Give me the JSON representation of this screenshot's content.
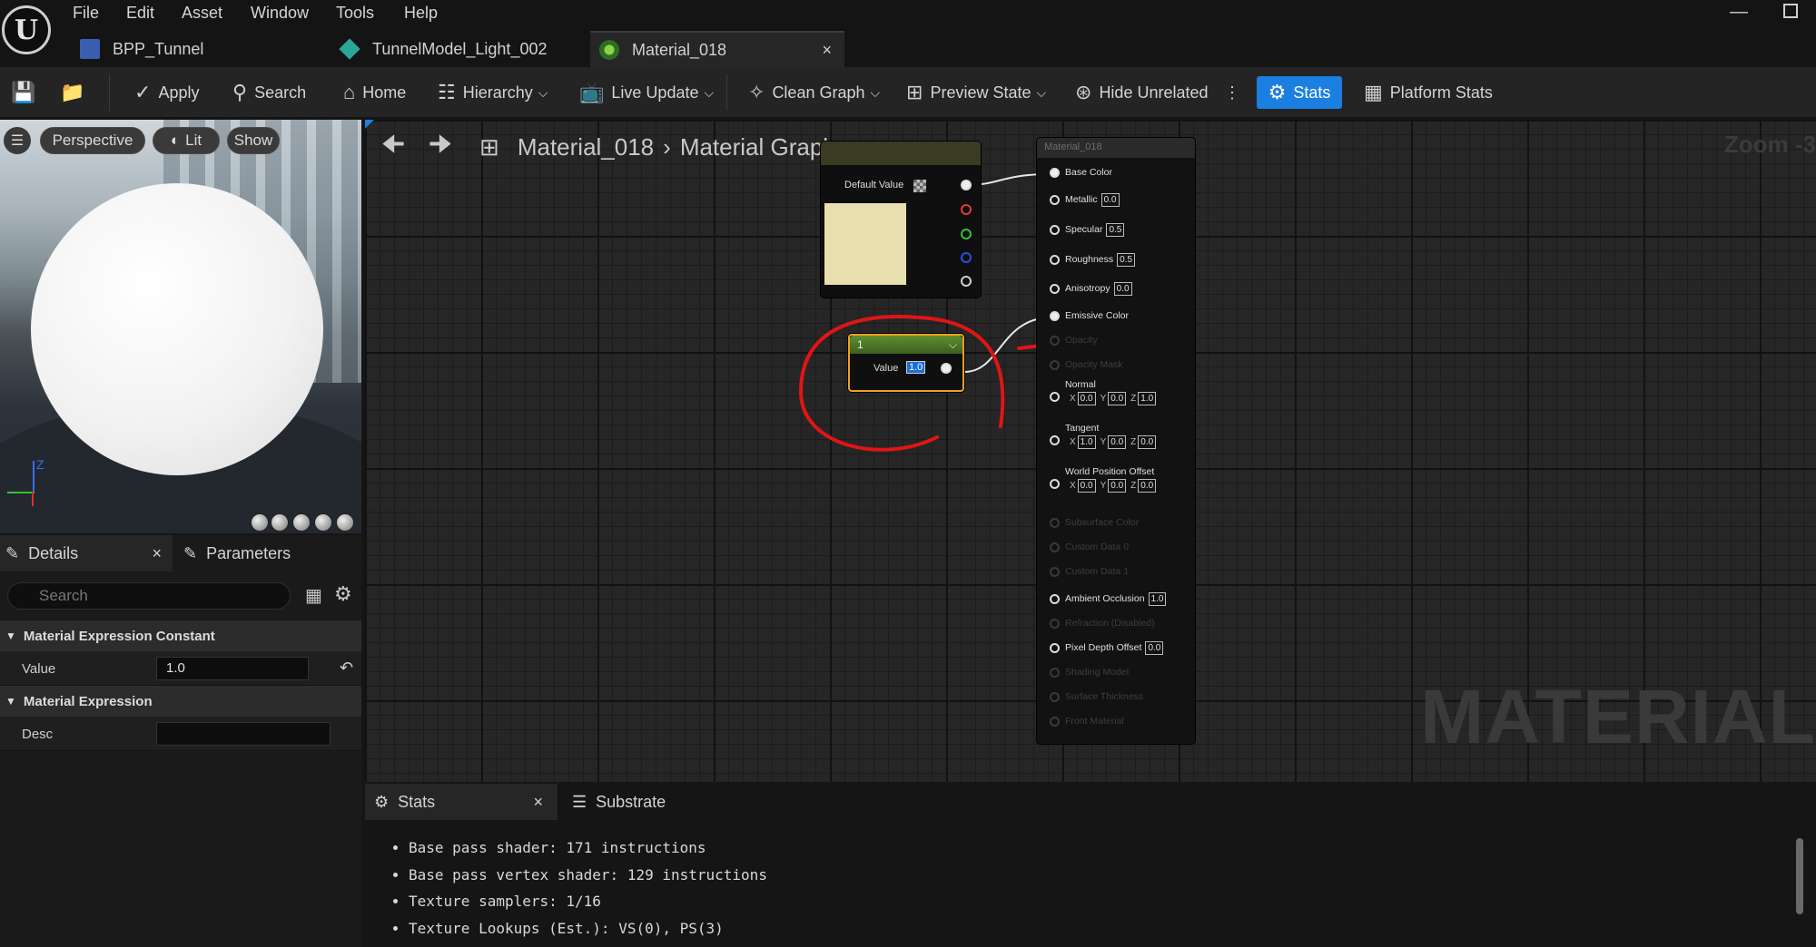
{
  "menu": [
    "File",
    "Edit",
    "Asset",
    "Window",
    "Tools",
    "Help"
  ],
  "tabs": [
    {
      "label": "BPP_Tunnel",
      "icon": "blueprint-icon"
    },
    {
      "label": "TunnelModel_Light_002",
      "icon": "mesh-icon"
    },
    {
      "label": "Material_018",
      "icon": "material-icon",
      "active": true
    }
  ],
  "toolbar": {
    "apply": "Apply",
    "search": "Search",
    "home": "Home",
    "hierarchy": "Hierarchy",
    "live_update": "Live Update",
    "clean_graph": "Clean Graph",
    "preview_state": "Preview State",
    "hide_unrelated": "Hide Unrelated",
    "stats": "Stats",
    "platform_stats": "Platform Stats"
  },
  "viewport": {
    "perspective": "Perspective",
    "lit": "Lit",
    "show": "Show",
    "axis_z": "Z"
  },
  "details": {
    "tab_details": "Details",
    "tab_parameters": "Parameters",
    "search_placeholder": "Search",
    "section1": "Material Expression Constant",
    "value_label": "Value",
    "value": "1.0",
    "section2": "Material Expression",
    "desc_label": "Desc",
    "desc_value": ""
  },
  "graph": {
    "breadcrumb_root": "Material_018",
    "breadcrumb_child": "Material Graph",
    "zoom_label": "Zoom -3",
    "watermark": "MATERIAL",
    "vector_node": {
      "default_value_label": "Default Value",
      "swatch_color": "#e8dfae"
    },
    "constant_node": {
      "title": "1",
      "value_label": "Value",
      "value": "1.0"
    },
    "material_node": {
      "title": "Material_018",
      "rows": [
        {
          "label": "Base Color",
          "connected": true
        },
        {
          "label": "Metallic",
          "value": "0.0"
        },
        {
          "label": "Specular",
          "value": "0.5"
        },
        {
          "label": "Roughness",
          "value": "0.5"
        },
        {
          "label": "Anisotropy",
          "value": "0.0"
        },
        {
          "label": "Emissive Color",
          "connected": true
        },
        {
          "label": "Opacity",
          "dim": true
        },
        {
          "label": "Opacity Mask",
          "dim": true
        }
      ],
      "normal": {
        "label": "Normal",
        "x": "0.0",
        "y": "0.0",
        "z": "1.0"
      },
      "tangent": {
        "label": "Tangent",
        "x": "1.0",
        "y": "0.0",
        "z": "0.0"
      },
      "wpo": {
        "label": "World Position Offset",
        "x": "0.0",
        "y": "0.0",
        "z": "0.0"
      },
      "rows2": [
        {
          "label": "Subsurface Color",
          "dim": true
        },
        {
          "label": "Custom Data 0",
          "dim": true
        },
        {
          "label": "Custom Data 1",
          "dim": true
        },
        {
          "label": "Ambient Occlusion",
          "value": "1.0"
        },
        {
          "label": "Refraction (Disabled)",
          "dim": true
        },
        {
          "label": "Pixel Depth Offset",
          "value": "0.0"
        },
        {
          "label": "Shading Model",
          "dim": true
        },
        {
          "label": "Surface Thickness",
          "dim": true
        },
        {
          "label": "Front Material",
          "dim": true
        }
      ]
    }
  },
  "stats": {
    "tab_stats": "Stats",
    "tab_substrate": "Substrate",
    "lines": [
      "Base pass shader: 171 instructions",
      "Base pass vertex shader: 129 instructions",
      "Texture samplers: 1/16",
      "Texture Lookups (Est.): VS(0), PS(3)"
    ]
  },
  "colors": {
    "accent": "#1a7fe0",
    "annotation": "#e01515",
    "constant_header": "#4f7a28"
  }
}
